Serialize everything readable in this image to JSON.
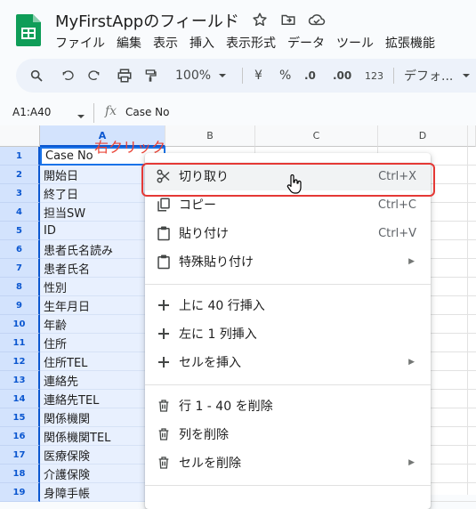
{
  "header": {
    "title": "MyFirstAppのフィールド",
    "menu": [
      "ファイル",
      "編集",
      "表示",
      "挿入",
      "表示形式",
      "データ",
      "ツール",
      "拡張機能"
    ]
  },
  "toolbar": {
    "zoom": "100%",
    "currency": "¥",
    "percent": "%",
    "dec_decrease": ".0",
    "dec_increase": ".00",
    "number_format": "123",
    "font": "デフォ..."
  },
  "formula_bar": {
    "name_box": "A1:A40",
    "fx": "fx",
    "value": "Case No"
  },
  "grid": {
    "columns": [
      "A",
      "B",
      "C",
      "D"
    ],
    "rows": [
      {
        "num": "1",
        "value": "Case No"
      },
      {
        "num": "2",
        "value": "開始日"
      },
      {
        "num": "3",
        "value": "終了日"
      },
      {
        "num": "4",
        "value": "担当SW"
      },
      {
        "num": "5",
        "value": "ID"
      },
      {
        "num": "6",
        "value": "患者氏名読み"
      },
      {
        "num": "7",
        "value": "患者氏名"
      },
      {
        "num": "8",
        "value": "性別"
      },
      {
        "num": "9",
        "value": "生年月日"
      },
      {
        "num": "10",
        "value": "年齢"
      },
      {
        "num": "11",
        "value": "住所"
      },
      {
        "num": "12",
        "value": "住所TEL"
      },
      {
        "num": "13",
        "value": "連絡先"
      },
      {
        "num": "14",
        "value": "連絡先TEL"
      },
      {
        "num": "15",
        "value": "関係機関"
      },
      {
        "num": "16",
        "value": "関係機関TEL"
      },
      {
        "num": "17",
        "value": "医療保険"
      },
      {
        "num": "18",
        "value": "介護保険"
      },
      {
        "num": "19",
        "value": "身障手帳"
      }
    ]
  },
  "annotation": "右クリック",
  "context_menu": {
    "cut": {
      "label": "切り取り",
      "shortcut": "Ctrl+X"
    },
    "copy": {
      "label": "コピー",
      "shortcut": "Ctrl+C"
    },
    "paste": {
      "label": "貼り付け",
      "shortcut": "Ctrl+V"
    },
    "paste_special": {
      "label": "特殊貼り付け"
    },
    "insert_rows": {
      "label": "上に 40 行挿入"
    },
    "insert_col": {
      "label": "左に 1 列挿入"
    },
    "insert_cells": {
      "label": "セルを挿入"
    },
    "delete_rows": {
      "label": "行 1 - 40 を削除"
    },
    "delete_col": {
      "label": "列を削除"
    },
    "delete_cells": {
      "label": "セルを削除"
    }
  },
  "colors": {
    "accent": "#0b57d0",
    "selection": "#e8f0fe",
    "annotation": "#ea4335"
  }
}
